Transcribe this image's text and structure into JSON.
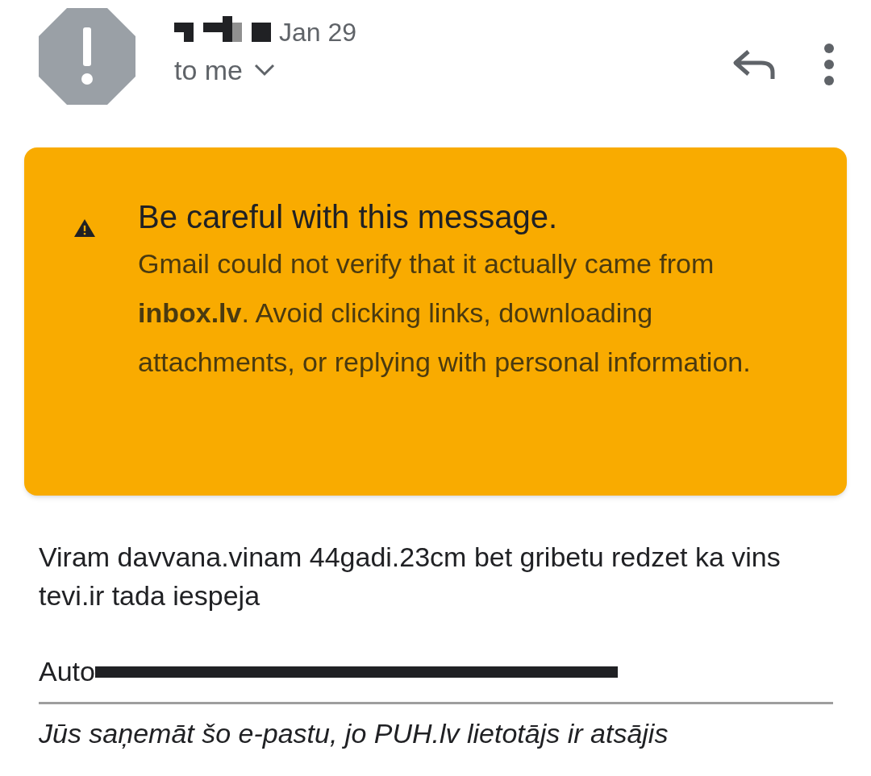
{
  "header": {
    "date": "Jan 29",
    "recipient": "to me"
  },
  "warning": {
    "title": "Be careful with this message.",
    "message": "Gmail could not verify that it actually came from **inbox.lv**. Avoid clicking links, downloading attachments, or replying with personal information."
  },
  "body": {
    "paragraphs": [
      "Viram davvana.vinam 44gadi.23cm bet gribetu redzet ka vins tevi.ir tada iespeja"
    ],
    "author_label": "Auto",
    "footer": "Jūs saņemāt šo e-pastu, jo PUH.lv lietotājs ir atsājis"
  }
}
